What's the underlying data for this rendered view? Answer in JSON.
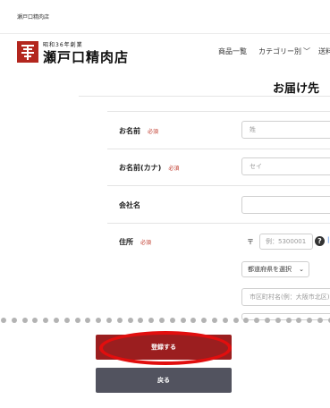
{
  "topbar": {
    "shop_name": "瀬戸口精肉店"
  },
  "logo": {
    "sub": "昭和36年創業",
    "name": "瀬戸口精肉店"
  },
  "nav": {
    "items": [
      "商品一覧",
      "カテゴリー別",
      "送料"
    ]
  },
  "page": {
    "title": "お届け先"
  },
  "form": {
    "required_label": "必須",
    "name": {
      "label": "お名前",
      "placeholder": "姓"
    },
    "kana": {
      "label": "お名前(カナ)",
      "placeholder": "セイ"
    },
    "company": {
      "label": "会社名",
      "placeholder": ""
    },
    "address": {
      "label": "住所",
      "postal_mark": "〒",
      "postal_placeholder": "例：5300001",
      "prefecture_select": "都道府県を選択",
      "city_placeholder": "市区町村名(例：大阪市北区)"
    }
  },
  "buttons": {
    "submit": "登録する",
    "back": "戻る"
  },
  "colors": {
    "submit_bg": "#9b1e1f",
    "back_bg": "#52535f",
    "required": "#c0392b",
    "annotation": "#e10e0e"
  },
  "icons": {
    "help": "question-circle-icon",
    "logo_mark": "brand-crest-icon"
  }
}
